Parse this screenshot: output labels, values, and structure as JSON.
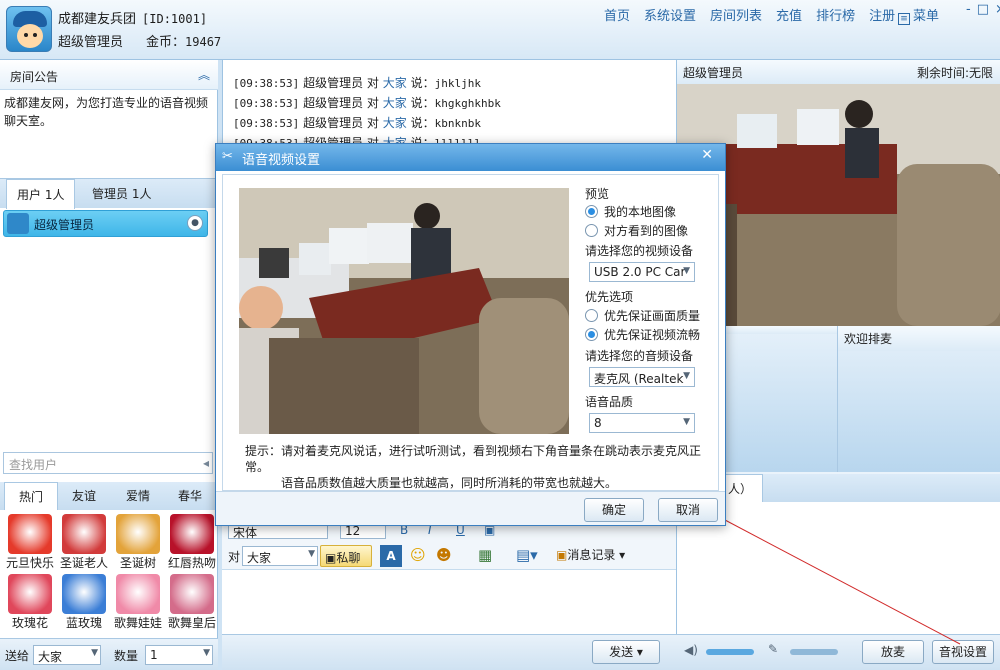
{
  "header": {
    "title": "成都建友兵团",
    "room_id": "[ID:1001]",
    "user": "超级管理员",
    "coins_label": "金币：",
    "coins": "19467",
    "nav": [
      "首页",
      "系统设置",
      "房间列表",
      "充值",
      "排行榜",
      "注册"
    ],
    "menu": "菜单",
    "window_controls": "-□×"
  },
  "left": {
    "notice_title": "房间公告",
    "notice_text": "成都建友网，为您打造专业的语音视频聊天室。",
    "tabs": [
      "用户 1人",
      "管理员 1人"
    ],
    "users": [
      {
        "name": "超级管理员"
      }
    ],
    "search_placeholder": "查找用户",
    "gift_tabs": [
      "热门",
      "友谊",
      "爱情",
      "春华"
    ],
    "gifts": [
      {
        "name": "元旦快乐",
        "color": "#e53a2b"
      },
      {
        "name": "圣诞老人",
        "color": "#d23b3b"
      },
      {
        "name": "圣诞树",
        "color": "#e3a33a"
      },
      {
        "name": "红唇热吻",
        "color": "#b8122a"
      },
      {
        "name": "玫瑰花",
        "color": "#e0475b"
      },
      {
        "name": "蓝玫瑰",
        "color": "#3b7ed6"
      },
      {
        "name": "歌舞娃娃",
        "color": "#f08aa8"
      },
      {
        "name": "歌舞皇后",
        "color": "#d46c8a"
      }
    ],
    "send_label": "送给",
    "send_target": "大家",
    "qty_label": "数量",
    "qty_value": "1"
  },
  "chat": {
    "lines": [
      {
        "time": "[09:38:53]",
        "from": "超级管理员",
        "to_prefix": "对",
        "to": "大家",
        "say": "说：",
        "msg": "jhkljhk"
      },
      {
        "time": "[09:38:53]",
        "from": "超级管理员",
        "to_prefix": "对",
        "to": "大家",
        "say": "说：",
        "msg": "khgkghkhbk"
      },
      {
        "time": "[09:38:53]",
        "from": "超级管理员",
        "to_prefix": "对",
        "to": "大家",
        "say": "说：",
        "msg": "kbnknbk"
      },
      {
        "time": "[09:38:53]",
        "from": "超级管理员",
        "to_prefix": "对",
        "to": "大家",
        "say": "说：",
        "msg": "lllllll"
      }
    ],
    "font_name": "宋体",
    "font_size": "12",
    "to_label": "对",
    "to_target": "大家",
    "private_label": "私聊",
    "history_label": "消息记录",
    "send_button": "发送"
  },
  "right": {
    "video_user": "超级管理员",
    "time_left": "剩余时间:无限",
    "mic_slots": [
      "",
      "欢迎排麦"
    ],
    "private_tab": "人）",
    "release_mic": "放麦",
    "av_settings": "音视设置"
  },
  "dialog": {
    "title": "语音视频设置",
    "preview_label": "预览",
    "preview_options": [
      "我的本地图像",
      "对方看到的图像"
    ],
    "preview_selected": 0,
    "video_device_label": "请选择您的视频设备",
    "video_device": "USB 2.0 PC Car",
    "priority_label": "优先选项",
    "priority_options": [
      "优先保证画面质量",
      "优先保证视频流畅"
    ],
    "priority_selected": 1,
    "audio_device_label": "请选择您的音频设备",
    "audio_device": "麦克风 (Realtek",
    "quality_label": "语音品质",
    "quality": "8",
    "tip_line1": "提示：请对着麦克风说话，进行试听测试，看到视频右下角音量条在跳动表示麦克风正常。",
    "tip_line2": "语音品质数值越大质量也就越高，同时所消耗的带宽也就越大。",
    "ok": "确定",
    "cancel": "取消"
  }
}
